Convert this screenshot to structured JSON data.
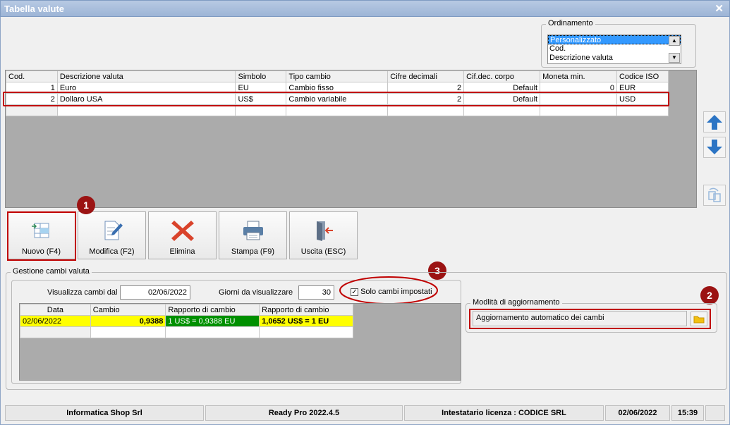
{
  "window": {
    "title": "Tabella valute",
    "close_glyph": "✕"
  },
  "ordering": {
    "legend": "Ordinamento",
    "options": [
      "Personalizzato",
      "Cod.",
      "Descrizione valuta"
    ],
    "selected": "Personalizzato"
  },
  "grid": {
    "columns": [
      "Cod.",
      "Descrizione valuta",
      "Simbolo",
      "Tipo cambio",
      "Cifre decimali",
      "Cif.dec. corpo",
      "Moneta min.",
      "Codice ISO"
    ],
    "rows": [
      [
        "1",
        "Euro",
        "EU",
        "Cambio fisso",
        "2",
        "Default",
        "0",
        "EUR"
      ],
      [
        "2",
        "Dollaro USA",
        "US$",
        "Cambio variabile",
        "2",
        "Default",
        "",
        "USD"
      ]
    ]
  },
  "toolbar": {
    "new_label": "Nuovo (F4)",
    "edit_label": "Modifica (F2)",
    "delete_label": "Elimina",
    "print_label": "Stampa (F9)",
    "exit_label": "Uscita (ESC)"
  },
  "badges": [
    "1",
    "2",
    "3"
  ],
  "gestione": {
    "legend": "Gestione cambi valuta",
    "date_from_label": "Visualizza cambi dal",
    "date_from_value": "02/06/2022",
    "days_label": "Giorni da visualizzare",
    "days_value": "30",
    "only_set_label": "Solo cambi impostati",
    "only_set_checked": true,
    "rates_columns": [
      "Data",
      "Cambio",
      "Rapporto di cambio",
      "Rapporto di cambio"
    ],
    "rates_rows": [
      [
        "02/06/2022",
        "0,9388",
        "1 US$ = 0,9388 EU",
        "1,0652 US$ = 1 EU"
      ]
    ]
  },
  "update_mode": {
    "legend": "Modlità di aggiornamento",
    "value": "Aggiornamento automatico dei cambi"
  },
  "status": {
    "company": "Informatica Shop Srl",
    "version": "Ready Pro 2022.4.5",
    "license": "Intestatario licenza : CODICE SRL",
    "date": "02/06/2022",
    "time": "15:39"
  },
  "colors": {
    "accent_red": "#c00000",
    "badge": "#9b1313",
    "highlight_yellow": "#ffff00",
    "ratio_green": "#009000"
  }
}
